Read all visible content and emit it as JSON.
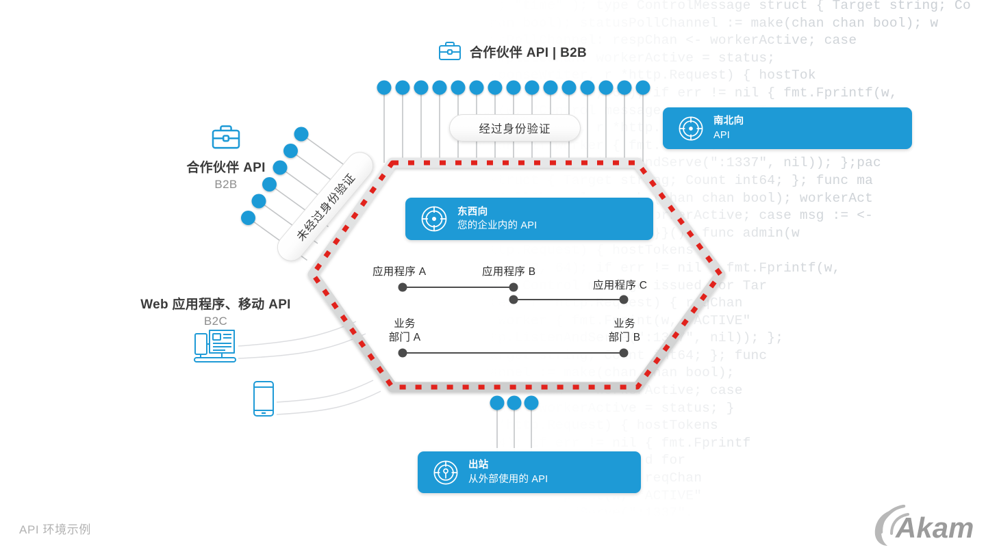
{
  "caption": "API 环境示例",
  "brand": {
    "name": "Akamai",
    "color": "#1e9ad6"
  },
  "top_channel": {
    "label": "合作伙伴 API | B2B",
    "icon": "briefcase-icon",
    "auth_pill": "经过身份验证",
    "dot_count": 15
  },
  "left_channel": {
    "title": "合作伙伴 API",
    "subtitle": "B2B",
    "icon": "briefcase-icon",
    "auth_pill": "未经过身份验证",
    "dot_count": 6
  },
  "bottom_left_channel": {
    "title": "Web 应用程序、移动 API",
    "subtitle": "B2C",
    "icons": [
      "desktop-computer-icon",
      "mobile-phone-icon"
    ]
  },
  "badges": [
    {
      "id": "north-south",
      "title": "南北向",
      "subtitle": "API",
      "icon": "crosshair-target-icon",
      "color": "#1e9ad6"
    },
    {
      "id": "east-west",
      "title": "东西向",
      "subtitle": "您的企业内的 API",
      "icon": "crosshair-target-icon",
      "color": "#1e9ad6"
    },
    {
      "id": "outbound",
      "title": "出站",
      "subtitle": "从外部使用的 API",
      "icon": "outbound-target-icon",
      "color": "#1e9ad6"
    }
  ],
  "interior_nodes": {
    "apps": [
      "应用程序 A",
      "应用程序 B",
      "应用程序 C"
    ],
    "business_units": [
      "业务\n部门 A",
      "业务\n部门 B"
    ]
  },
  "outbound_dots": 3,
  "perimeter": {
    "band_color": "#d9dadb",
    "dash_color": "#e1211b"
  },
  "code_background": [
    "             ; ;       ; ; \"time\" ); type ControlMessage struct { Target string; Co",
    "             : =  make(chan bool); statusPollChannel := make(chan chan bool); w",
    "          n    case statusPollChannel: respChan <- workerActive; case",
    "        s :=  <- workerCompleteChan: workerActive = status;",
    "     unc admin(w http.ResponseWriter, r *http.Request) { hostTok",
    "      rseInt(r.FormValue(\"count\"), 10, 64); if err != nil { fmt.Fprintf(w,",
    "        ;  }  fmt.Fprintf(w, \"Control message issued for Tar",
    "        tatus(w http.ResponseWriter, r *http.Request) { reqChan",
    "          orker = <-reqChan; if worker { fmt.Fprint(w, \"ACTIVE\"",
    "          llChannel; log.Fatal(http.ListenAndServe(\":1337\", nil)); };pac",
    "           ntrolMessage struct { Target string; Count int64; }; func ma",
    "          n bool); statusPollChannel := make(chan chan bool); workerAct",
    "       case statusPollChannel: respChan <- workerActive; case msg := <-",
    "            eteChan: workerActive = status; }}(); func admin(w",
    "          seWriter, r *http.Request) { hostTokens",
    "            Value(\"count\"), 10, 64); if err != nil { fmt.Fprintf(w,",
    "            fmt.Fprintf(w, \"Control message issued for Tar",
    "          tp.ResponseWriter, r *http.Request) { reqChan",
    "           <-reqChan; if worker { fmt.Fprint(w, \"ACTIVE\"",
    "            log.Fatal(http.ListenAndServe(\":1337\", nil)); };",
    "            e struct { Target string; Count int64; }; func",
    "            statusPollChannel := make(chan chan bool);",
    "          usPollChannel: respChan <- workerActive; case",
    "            rkerCompleteChan: workerActive = status; }",
    "            nseWriter, r *http.Request) { hostTokens",
    "            ount\"), 10, 64); if err != nil { fmt.Fprintf",
    "            rintf(w, \"Control message issued for",
    "            onseWriter, r *http.Request) { reqChan",
    "            an; if worker { fmt.Fprint(w, \"ACTIVE\"",
    "            og.Fatal(http.ListenAndServe(\":1337\","
  ]
}
